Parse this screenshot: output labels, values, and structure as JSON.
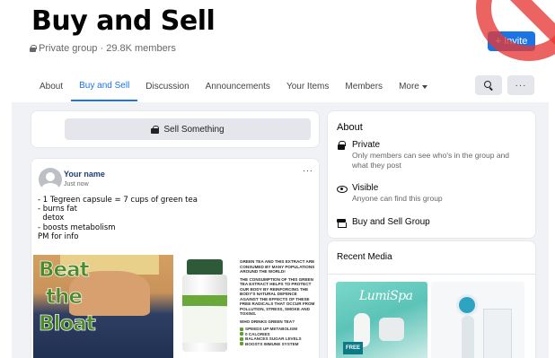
{
  "header": {
    "title": "Buy and Sell",
    "meta": "Private group · 29.8K members",
    "invite_label": "+ Invite"
  },
  "tabs": [
    {
      "label": "About"
    },
    {
      "label": "Buy and Sell",
      "active": true
    },
    {
      "label": "Discussion"
    },
    {
      "label": "Announcements"
    },
    {
      "label": "Your Items"
    },
    {
      "label": "Members"
    },
    {
      "label": "More"
    }
  ],
  "toolbar": {
    "search_icon": "search-icon",
    "more_label": "···"
  },
  "sell": {
    "label": "Sell Something",
    "icon": "bag-icon"
  },
  "post": {
    "author": "Your name",
    "time": "Just now",
    "menu": "···",
    "lines": [
      "- 1 Tegreen capsule = 7 cups of green tea",
      "- burns fat",
      "  detox",
      "- boosts metabolism",
      "PM for info"
    ],
    "image_words": [
      "Beat",
      "the",
      "Bloat"
    ],
    "info_paragraphs": [
      "GREEN TEA AND THIS EXTRACT ARE CONSUMED BY MANY POPULATIONS AROUND THE WORLD!",
      "THE CONSUMPTION OF THIS GREEN TEA EXTRACT HELPS TO PROTECT OUR BODY BY REINFORCING THE BODY'S NATURAL DEFENCE AGAINST THE EFFECTS OF THESE FREE RADICALS THAT OCCUR FROM POLLUTION, STRESS, SMOKE AND TOXINS.",
      "WHO DRINKS GREEN TEA?"
    ],
    "info_checks": [
      "SPEEDS UP METABOLISM",
      "0 CALORIES",
      "BALANCES SUGAR LEVELS",
      "BOOSTS IMMUNE SYSTEM"
    ]
  },
  "about": {
    "title": "About",
    "items": [
      {
        "icon": "lock-icon",
        "heading": "Private",
        "sub": "Only members can see who's in the group and what they post"
      },
      {
        "icon": "eye-icon",
        "heading": "Visible",
        "sub": "Anyone can find this group"
      },
      {
        "icon": "store-icon",
        "heading": "Buy and Sell Group",
        "sub": ""
      }
    ]
  },
  "media": {
    "title": "Recent Media",
    "thumb1_text": "LumiSpa",
    "thumb1_badge": "FREE"
  },
  "colors": {
    "accent": "#1b74e4",
    "page_bg": "#f0f2f5",
    "no_sign": "#e53935"
  }
}
